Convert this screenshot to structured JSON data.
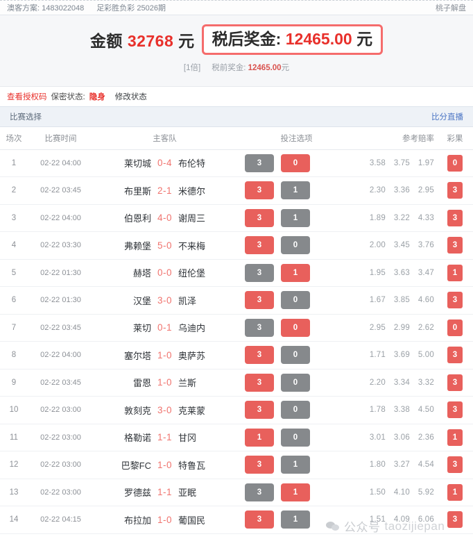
{
  "meta": {
    "scheme_label": "澳客方案: 1483022048",
    "lottery_label": "足彩胜负彩 25026期",
    "brand": "桃子解盘"
  },
  "summary": {
    "amount_prefix": "金额",
    "amount_value": "32768",
    "amount_unit": "元",
    "prize_label": "税后奖金:",
    "prize_value": "12465.00",
    "prize_unit": "元",
    "multiple": "[1倍]",
    "pretax_label": "税前奖金:",
    "pretax_value": "12465.00",
    "pretax_unit": "元"
  },
  "status": {
    "auth_code_link": "查看授权码",
    "privacy_label": "保密状态:",
    "privacy_value": "隐身",
    "modify_link": "修改状态"
  },
  "selection": {
    "title": "比赛选择",
    "live_link": "比分直播"
  },
  "table": {
    "headers": [
      "场次",
      "比赛时间",
      "主客队",
      "投注选项",
      "参考赔率",
      "彩果"
    ],
    "rows": [
      {
        "no": "1",
        "time": "02-22 04:00",
        "home": "莱切城",
        "score": "0-4",
        "away": "布伦特",
        "opts": [
          {
            "v": "3",
            "c": "gray"
          },
          {
            "v": "0",
            "c": "red"
          }
        ],
        "odds": [
          "3.58",
          "3.75",
          "1.97"
        ],
        "result": "0"
      },
      {
        "no": "2",
        "time": "02-22 03:45",
        "home": "布里斯",
        "score": "2-1",
        "away": "米德尔",
        "opts": [
          {
            "v": "3",
            "c": "red"
          },
          {
            "v": "1",
            "c": "gray"
          }
        ],
        "odds": [
          "2.30",
          "3.36",
          "2.95"
        ],
        "result": "3"
      },
      {
        "no": "3",
        "time": "02-22 04:00",
        "home": "伯恩利",
        "score": "4-0",
        "away": "谢周三",
        "opts": [
          {
            "v": "3",
            "c": "red"
          },
          {
            "v": "1",
            "c": "gray"
          }
        ],
        "odds": [
          "1.89",
          "3.22",
          "4.33"
        ],
        "result": "3"
      },
      {
        "no": "4",
        "time": "02-22 03:30",
        "home": "弗赖堡",
        "score": "5-0",
        "away": "不来梅",
        "opts": [
          {
            "v": "3",
            "c": "red"
          },
          {
            "v": "0",
            "c": "gray"
          }
        ],
        "odds": [
          "2.00",
          "3.45",
          "3.76"
        ],
        "result": "3"
      },
      {
        "no": "5",
        "time": "02-22 01:30",
        "home": "赫塔",
        "score": "0-0",
        "away": "纽伦堡",
        "opts": [
          {
            "v": "3",
            "c": "gray"
          },
          {
            "v": "1",
            "c": "red"
          }
        ],
        "odds": [
          "1.95",
          "3.63",
          "3.47"
        ],
        "result": "1"
      },
      {
        "no": "6",
        "time": "02-22 01:30",
        "home": "汉堡",
        "score": "3-0",
        "away": "凯泽",
        "opts": [
          {
            "v": "3",
            "c": "red"
          },
          {
            "v": "0",
            "c": "gray"
          }
        ],
        "odds": [
          "1.67",
          "3.85",
          "4.60"
        ],
        "result": "3"
      },
      {
        "no": "7",
        "time": "02-22 03:45",
        "home": "莱切",
        "score": "0-1",
        "away": "乌迪内",
        "opts": [
          {
            "v": "3",
            "c": "gray"
          },
          {
            "v": "0",
            "c": "red"
          }
        ],
        "odds": [
          "2.95",
          "2.99",
          "2.62"
        ],
        "result": "0"
      },
      {
        "no": "8",
        "time": "02-22 04:00",
        "home": "塞尔塔",
        "score": "1-0",
        "away": "奥萨苏",
        "opts": [
          {
            "v": "3",
            "c": "red"
          },
          {
            "v": "0",
            "c": "gray"
          }
        ],
        "odds": [
          "1.71",
          "3.69",
          "5.00"
        ],
        "result": "3"
      },
      {
        "no": "9",
        "time": "02-22 03:45",
        "home": "雷恩",
        "score": "1-0",
        "away": "兰斯",
        "opts": [
          {
            "v": "3",
            "c": "red"
          },
          {
            "v": "0",
            "c": "gray"
          }
        ],
        "odds": [
          "2.20",
          "3.34",
          "3.32"
        ],
        "result": "3"
      },
      {
        "no": "10",
        "time": "02-22 03:00",
        "home": "敦刻克",
        "score": "3-0",
        "away": "克莱蒙",
        "opts": [
          {
            "v": "3",
            "c": "red"
          },
          {
            "v": "0",
            "c": "gray"
          }
        ],
        "odds": [
          "1.78",
          "3.38",
          "4.50"
        ],
        "result": "3"
      },
      {
        "no": "11",
        "time": "02-22 03:00",
        "home": "格勒诺",
        "score": "1-1",
        "away": "甘冈",
        "opts": [
          {
            "v": "1",
            "c": "red"
          },
          {
            "v": "0",
            "c": "gray"
          }
        ],
        "odds": [
          "3.01",
          "3.06",
          "2.36"
        ],
        "result": "1"
      },
      {
        "no": "12",
        "time": "02-22 03:00",
        "home": "巴黎FC",
        "score": "1-0",
        "away": "特鲁瓦",
        "opts": [
          {
            "v": "3",
            "c": "red"
          },
          {
            "v": "1",
            "c": "gray"
          }
        ],
        "odds": [
          "1.80",
          "3.27",
          "4.54"
        ],
        "result": "3"
      },
      {
        "no": "13",
        "time": "02-22 03:00",
        "home": "罗德兹",
        "score": "1-1",
        "away": "亚眠",
        "opts": [
          {
            "v": "3",
            "c": "gray"
          },
          {
            "v": "1",
            "c": "red"
          }
        ],
        "odds": [
          "1.50",
          "4.10",
          "5.92"
        ],
        "result": "1"
      },
      {
        "no": "14",
        "time": "02-22 04:15",
        "home": "布拉加",
        "score": "1-0",
        "away": "葡国民",
        "opts": [
          {
            "v": "3",
            "c": "red"
          },
          {
            "v": "1",
            "c": "gray"
          }
        ],
        "odds": [
          "1.51",
          "4.09",
          "6.06"
        ],
        "result": "3"
      }
    ]
  },
  "watermark": {
    "cn": "公众号",
    "en": "taozijiepan"
  },
  "colors": {
    "red": "#e8605c",
    "gray": "#86898c",
    "accent_red": "#e8302b",
    "link_blue": "#4a74c4"
  }
}
